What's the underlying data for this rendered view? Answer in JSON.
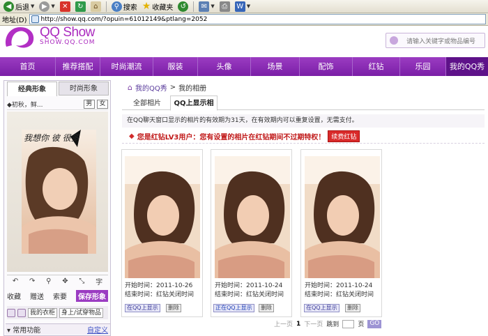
{
  "toolbar": {
    "back": "后退",
    "search": "搜索",
    "favorites": "收藏夹"
  },
  "address": {
    "label": "地址(D)",
    "url": "http://show.qq.com/?opuin=61012149&ptlang=2052"
  },
  "header": {
    "logo": "QQ Show",
    "logo_sub": "SHOW.QQ.COM",
    "search_placeholder": "请输入关键字或物品编号"
  },
  "nav": {
    "items": [
      "首页",
      "推荐搭配",
      "时尚潮流",
      "服装",
      "头像",
      "场景",
      "配饰",
      "红钻",
      "乐园",
      "我的QQ秀"
    ],
    "active_index": 9
  },
  "left": {
    "tab_classic": "经典形象",
    "tab_fashion": "时尚形象",
    "selector_text": "◆初秋，鲜...",
    "male": "男",
    "female": "女",
    "preview_caption": "我想你 彼 很多",
    "tools": [
      "↶",
      "↷",
      "⚲",
      "✥",
      "⤡",
      "字"
    ],
    "actions": {
      "collect": "收藏",
      "gift": "赠送",
      "buy": "索要",
      "save": "保存形象"
    },
    "wardrobe": "我的衣柜",
    "try_on": "身上/试穿物品",
    "common": "▾ 常用功能",
    "customize": "自定义"
  },
  "main": {
    "breadcrumb": {
      "home": "我的QQ秀",
      "sep": ">",
      "current": "我的相册"
    },
    "tabs": [
      "全部相片",
      "QQ上显示相册"
    ],
    "notice": "在QQ聊天窗口显示的相片的有效期为31天，在有效期内可以重复设置，无需支付。",
    "vip_notice": "您是红钻LV3用户：您有设置的相片在红钻期间不过期特权！",
    "renew": "续费红钻",
    "cards": [
      {
        "start": "开始时间：2011-10-26",
        "end": "结束时间：红钻关闭时间",
        "show_btn": "在QQ上显示",
        "delete_btn": "删除",
        "show_active": false
      },
      {
        "start": "开始时间：2011-10-24",
        "end": "结束时间：红钻关闭时间",
        "show_btn": "正在QQ上显示",
        "delete_btn": "删除",
        "show_active": true
      },
      {
        "start": "开始时间：2011-10-24",
        "end": "结束时间：红钻关闭时间",
        "show_btn": "在QQ上显示",
        "delete_btn": "删除",
        "show_active": false
      }
    ],
    "pager": {
      "prev": "上一页",
      "current": "1",
      "next": "下一页",
      "jump": "跳到",
      "page": "页",
      "go": "GO"
    }
  },
  "colors": {
    "brand": "#9b3cc2",
    "nav_active": "#5e1289",
    "alert": "#c01818"
  }
}
